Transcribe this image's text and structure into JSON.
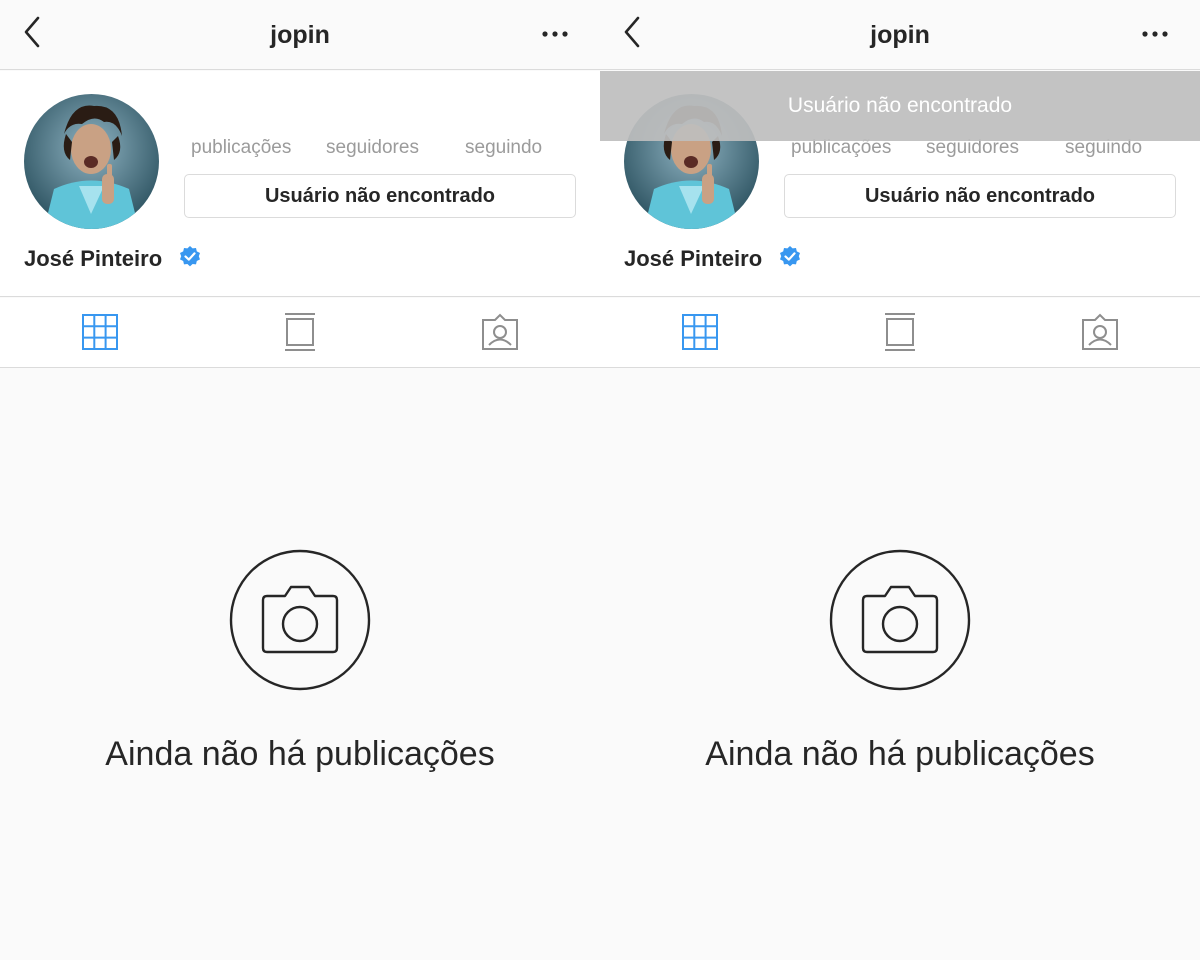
{
  "screens": [
    {
      "header": {
        "title": "jopin"
      },
      "profile": {
        "stats": {
          "posts_label": "publicações",
          "followers_label": "seguidores",
          "following_label": "seguindo"
        },
        "action_button": "Usuário não encontrado",
        "name": "José Pinteiro",
        "verified": true
      },
      "tabs": [
        "grid-icon",
        "feed-icon",
        "tagged-icon"
      ],
      "empty_state": {
        "message": "Ainda não há publicações"
      }
    },
    {
      "header": {
        "title": "jopin"
      },
      "toast": {
        "message": "Usuário não encontrado"
      },
      "profile": {
        "stats": {
          "posts_label": "publicações",
          "followers_label": "seguidores",
          "following_label": "seguindo"
        },
        "action_button": "Usuário não encontrado",
        "name": "José Pinteiro",
        "verified": true
      },
      "tabs": [
        "grid-icon",
        "feed-icon",
        "tagged-icon"
      ],
      "empty_state": {
        "message": "Ainda não há publicações"
      }
    }
  ],
  "colors": {
    "accent_blue": "#3897f0",
    "verified_blue": "#3897f0",
    "text_primary": "#262626",
    "text_secondary": "#9b9b9b",
    "divider": "#dbdbdb"
  }
}
